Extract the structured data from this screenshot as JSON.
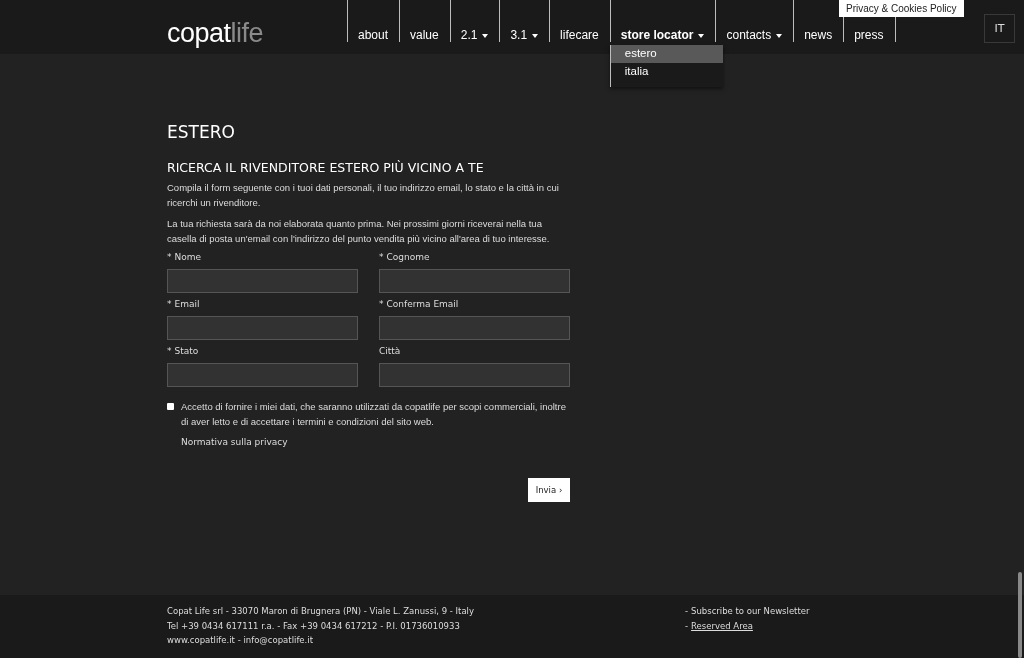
{
  "header": {
    "logo": {
      "main": "copat",
      "accent": "life"
    },
    "nav": [
      {
        "label": "about",
        "caret": false,
        "selected": false
      },
      {
        "label": "value",
        "caret": false,
        "selected": false
      },
      {
        "label": "2.1",
        "caret": true,
        "selected": false
      },
      {
        "label": "3.1",
        "caret": true,
        "selected": false
      },
      {
        "label": "lifecare",
        "caret": false,
        "selected": false
      },
      {
        "label": "store locator",
        "caret": true,
        "selected": true,
        "expanded": true,
        "children": [
          {
            "label": "estero",
            "selected": true
          },
          {
            "label": "italia",
            "selected": false
          }
        ]
      },
      {
        "label": "contacts",
        "caret": true,
        "selected": false
      },
      {
        "label": "news",
        "caret": false,
        "selected": false
      },
      {
        "label": "press",
        "caret": false,
        "selected": false
      }
    ],
    "privacy_tab": "Privacy & Cookies Policy",
    "language": "IT"
  },
  "page": {
    "title": "ESTERO",
    "subtitle": "RICERCA IL RIVENDITORE ESTERO PIÙ VICINO A TE",
    "paragraphs": [
      "Compila il form seguente con i tuoi dati personali, il tuo indirizzo email, lo stato e la città in cui ricerchi un rivenditore.",
      "La tua richiesta sarà da noi elaborata quanto prima. Nei prossimi giorni riceverai nella tua casella di posta un'email con l'indirizzo del punto vendita più vicino all'area di tuo interesse."
    ],
    "required_mark": "*",
    "fields": [
      {
        "label": "Nome",
        "required": true
      },
      {
        "label": "Cognome",
        "required": true
      },
      {
        "label": "Email",
        "required": true
      },
      {
        "label": "Conferma Email",
        "required": true
      },
      {
        "label": "Stato",
        "required": true
      },
      {
        "label": "Città",
        "required": false
      }
    ],
    "consent": {
      "checked": false,
      "text": "Accetto di fornire i miei dati, che saranno utilizzati da copatlife per scopi commerciali, inoltre di aver letto e di accettare i termini e condizioni del sito web.",
      "privacy_link": "Normativa sulla privacy"
    },
    "submit": "Invia ›"
  },
  "footer": {
    "left": [
      "Copat Life srl - 33070 Maron di Brugnera (PN) - Viale L. Zanussi, 9 - Italy",
      "Tel +39 0434 617111 r.a. - Fax +39 0434 617212 - P.I. 01736010933",
      "www.copatlife.it - info@copatlife.it"
    ],
    "right": [
      {
        "kind": "text",
        "dash": "-",
        "text": "Subscribe to our Newsletter"
      },
      {
        "kind": "link",
        "dash": "-",
        "text": "Reserved Area"
      }
    ]
  }
}
